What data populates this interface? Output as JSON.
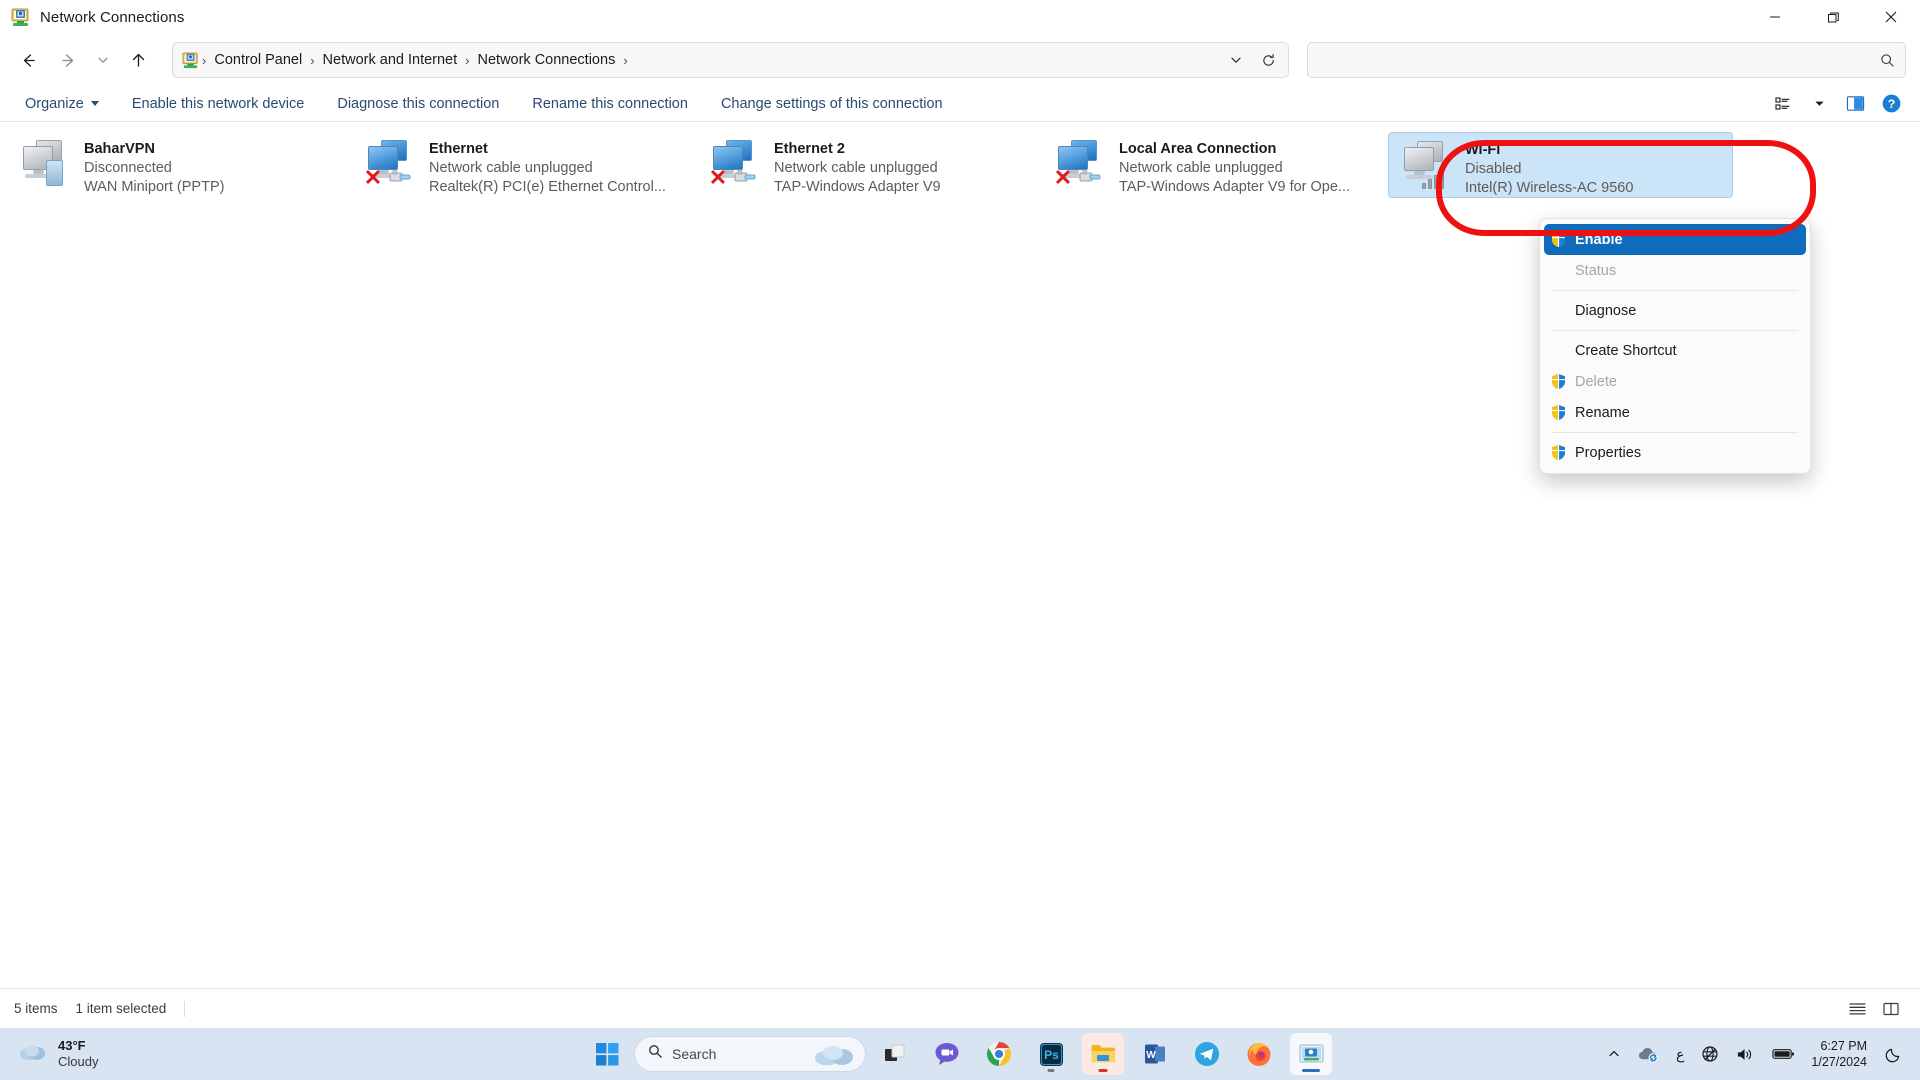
{
  "window": {
    "title": "Network Connections",
    "icon": "network-connections-icon",
    "controls": {
      "minimize": "Minimize",
      "maximize": "Restore",
      "close": "Close"
    }
  },
  "address_bar": {
    "back": "Back",
    "forward": "Forward",
    "recent": "Recent locations",
    "up": "Up",
    "icon": "network-connections-icon",
    "crumbs": [
      "Control Panel",
      "Network and Internet",
      "Network Connections"
    ],
    "separator": "›",
    "dropdown": "Previous locations",
    "refresh": "Refresh"
  },
  "search": {
    "value": "",
    "placeholder": "",
    "icon": "search-icon"
  },
  "command_bar": {
    "organize": "Organize",
    "items": [
      "Enable this network device",
      "Diagnose this connection",
      "Rename this connection",
      "Change settings of this connection"
    ],
    "view_options": "view-options-icon",
    "preview_pane": "preview-pane-icon",
    "help": "help-icon"
  },
  "connections": [
    {
      "name": "BaharVPN",
      "status": "Disconnected",
      "device": "WAN Miniport (PPTP)",
      "icon_style": "grey",
      "overlay": "vpn-lock",
      "disconnected": false,
      "selected": false
    },
    {
      "name": "Ethernet",
      "status": "Network cable unplugged",
      "device": "Realtek(R) PCI(e) Ethernet Control...",
      "icon_style": "blue",
      "overlay": "unplugged-cable",
      "disconnected": true,
      "selected": false
    },
    {
      "name": "Ethernet 2",
      "status": "Network cable unplugged",
      "device": "TAP-Windows Adapter V9",
      "icon_style": "blue",
      "overlay": "unplugged-cable",
      "disconnected": true,
      "selected": false
    },
    {
      "name": "Local Area Connection",
      "status": "Network cable unplugged",
      "device": "TAP-Windows Adapter V9 for Ope...",
      "icon_style": "blue",
      "overlay": "unplugged-cable",
      "disconnected": true,
      "selected": false
    },
    {
      "name": "Wi-Fi",
      "status": "Disabled",
      "device": "Intel(R) Wireless-AC 9560",
      "icon_style": "grey",
      "overlay": "signal-bars",
      "disconnected": false,
      "selected": true
    }
  ],
  "context_menu": [
    {
      "label": "Enable",
      "shield": true,
      "disabled": false,
      "highlight": true
    },
    {
      "label": "Status",
      "shield": false,
      "disabled": true,
      "highlight": false
    },
    {
      "separator": true
    },
    {
      "label": "Diagnose",
      "shield": false,
      "disabled": false,
      "highlight": false
    },
    {
      "separator": true
    },
    {
      "label": "Create Shortcut",
      "shield": false,
      "disabled": false,
      "highlight": false
    },
    {
      "label": "Delete",
      "shield": true,
      "disabled": true,
      "highlight": false
    },
    {
      "label": "Rename",
      "shield": true,
      "disabled": false,
      "highlight": false
    },
    {
      "separator": true
    },
    {
      "label": "Properties",
      "shield": true,
      "disabled": false,
      "highlight": false
    }
  ],
  "annotation": {
    "shape": "red-ellipse-highlight",
    "color": "#ee1111",
    "target": "Wi-Fi"
  },
  "status_bar": {
    "count": "5 items",
    "selection": "1 item selected",
    "details_view": "details-view-icon",
    "tiles_view": "tiles-view-icon"
  },
  "taskbar": {
    "weather": {
      "temperature": "43°F",
      "condition": "Cloudy",
      "icon": "cloud-icon"
    },
    "start": "start-icon",
    "search": {
      "label": "Search",
      "icon": "search-icon",
      "illustration": "cloud-illustration"
    },
    "apps": [
      {
        "name": "task-view",
        "label": "Task View",
        "state": "idle"
      },
      {
        "name": "chat",
        "label": "Chat",
        "state": "idle"
      },
      {
        "name": "google-chrome",
        "label": "Google Chrome",
        "state": "running"
      },
      {
        "name": "adobe-photoshop",
        "label": "Adobe Photoshop",
        "state": "running"
      },
      {
        "name": "file-explorer",
        "label": "File Explorer",
        "state": "running-highlight"
      },
      {
        "name": "microsoft-word",
        "label": "Microsoft Word",
        "state": "idle"
      },
      {
        "name": "telegram",
        "label": "Telegram",
        "state": "idle"
      },
      {
        "name": "mozilla-firefox",
        "label": "Mozilla Firefox",
        "state": "idle"
      },
      {
        "name": "network-connections",
        "label": "Network Connections",
        "state": "active"
      }
    ],
    "tray": {
      "show_hidden": "chevron-up-icon",
      "onedrive": "onedrive-sync-icon",
      "ime": "ع",
      "network": "network-disconnected-icon",
      "volume": "speaker-icon",
      "battery": "battery-icon",
      "time": "6:27 PM",
      "date": "1/27/2024",
      "notifications": "moon-icon"
    }
  }
}
